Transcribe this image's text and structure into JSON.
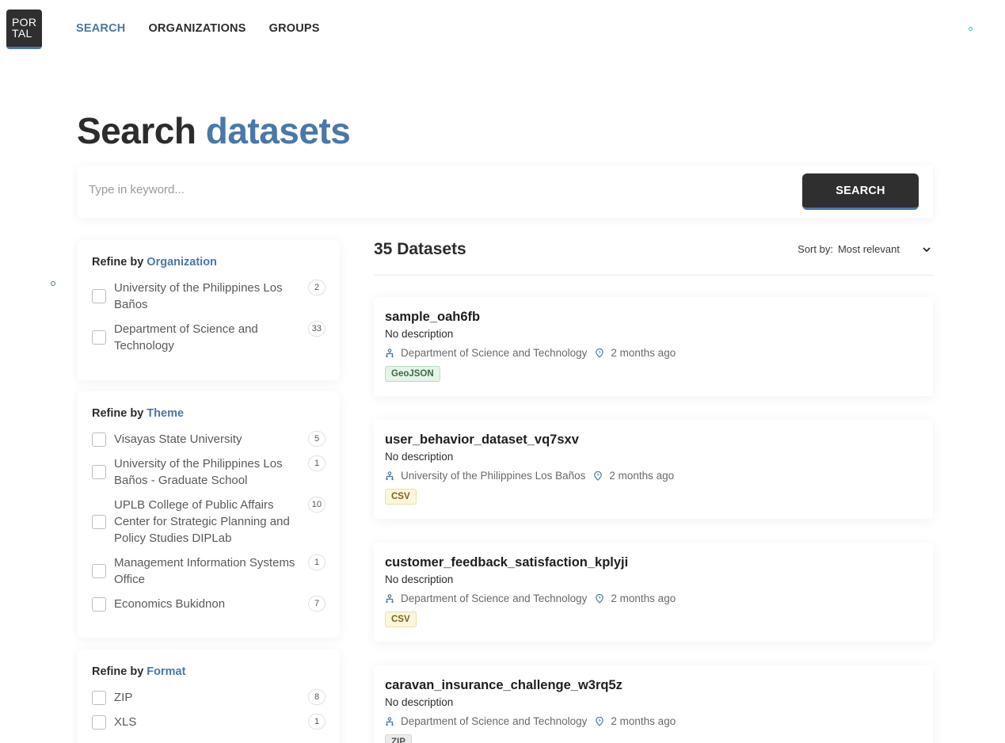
{
  "logo": {
    "line1": "POR",
    "line2": "TAL"
  },
  "nav": [
    {
      "label": "SEARCH",
      "active": true
    },
    {
      "label": "ORGANIZATIONS",
      "active": false
    },
    {
      "label": "GROUPS",
      "active": false
    }
  ],
  "title": {
    "main": "Search ",
    "accent": "datasets"
  },
  "search": {
    "placeholder": "Type in keyword...",
    "value": "",
    "button": "SEARCH"
  },
  "filters": {
    "organization": {
      "prefix": "Refine by ",
      "label": "Organization",
      "options": [
        {
          "label": "University of the Philippines Los Baños",
          "count": "2"
        },
        {
          "label": "Department of Science and Technology",
          "count": "33"
        }
      ]
    },
    "theme": {
      "prefix": "Refine by ",
      "label": "Theme",
      "options": [
        {
          "label": "Visayas State University",
          "count": "5"
        },
        {
          "label": "University of the Philippines Los Baños - Graduate School",
          "count": "1"
        },
        {
          "label": "UPLB College of Public Affairs Center for Strategic Planning and Policy Studies DIPLab",
          "count": "10"
        },
        {
          "label": "Management Information Systems Office",
          "count": "1"
        },
        {
          "label": "Economics Bukidnon",
          "count": "7"
        }
      ]
    },
    "format": {
      "prefix": "Refine by ",
      "label": "Format",
      "options": [
        {
          "label": "ZIP",
          "count": "8"
        },
        {
          "label": "XLS",
          "count": "1"
        }
      ]
    }
  },
  "results": {
    "count_label": "35 Datasets",
    "sort_label": "Sort by:",
    "sort_value": "Most relevant",
    "items": [
      {
        "name": "sample_oah6fb",
        "description": "No description",
        "organization": "Department of Science and Technology",
        "time": "2 months ago",
        "format": "GeoJSON"
      },
      {
        "name": "user_behavior_dataset_vq7sxv",
        "description": "No description",
        "organization": "University of the Philippines Los Baños",
        "time": "2 months ago",
        "format": "CSV"
      },
      {
        "name": "customer_feedback_satisfaction_kplyji",
        "description": "No description",
        "organization": "Department of Science and Technology",
        "time": "2 months ago",
        "format": "CSV"
      },
      {
        "name": "caravan_insurance_challenge_w3rq5z",
        "description": "No description",
        "organization": "Department of Science and Technology",
        "time": "2 months ago",
        "format": "ZIP"
      }
    ]
  },
  "colors": {
    "accent": "#4a78a8",
    "dark": "#2f2f2f",
    "geojson_bg": "#e6f4e8",
    "geojson_border": "#b9dcbf",
    "geojson_text": "#3b6b44",
    "csv_bg": "#fcf6dc",
    "csv_border": "#ecdfa5",
    "csv_text": "#7a6420",
    "zip_bg": "#ececec",
    "zip_border": "#d6d6d6",
    "zip_text": "#555555"
  }
}
